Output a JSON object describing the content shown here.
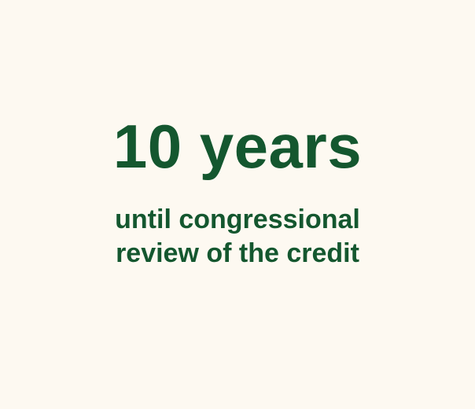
{
  "stat": {
    "value": "10 years",
    "caption_line_1": "until congressional",
    "caption_line_2": "review of the credit"
  },
  "colors": {
    "background": "#fdf9f1",
    "text": "#14572f"
  }
}
